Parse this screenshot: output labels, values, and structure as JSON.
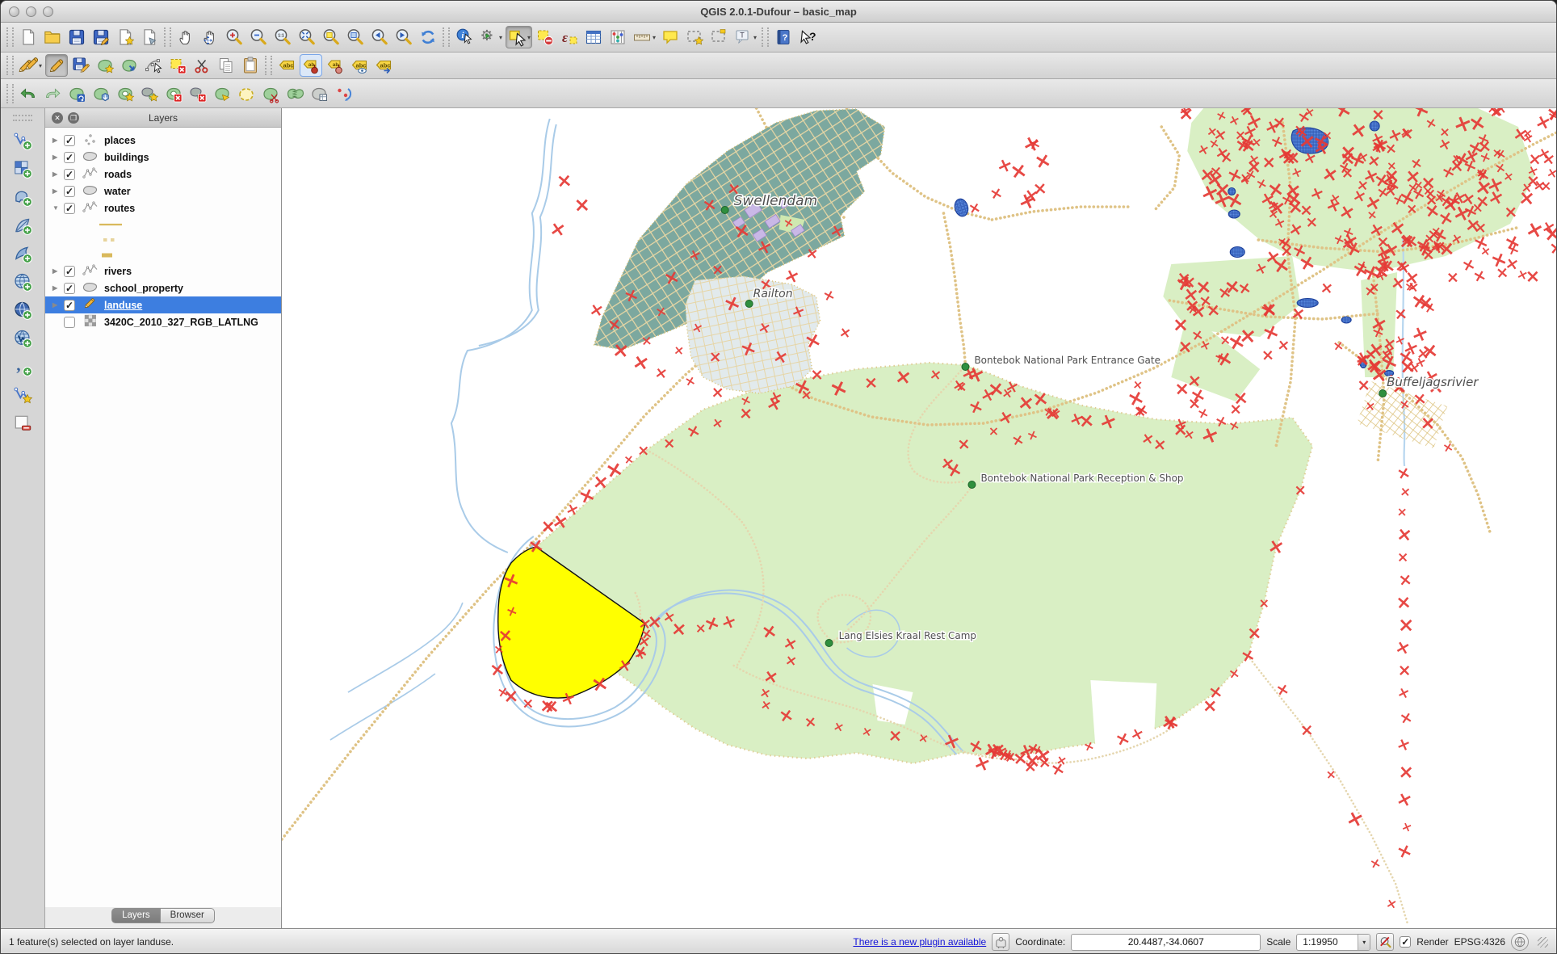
{
  "window": {
    "title": "QGIS 2.0.1-Dufour – basic_map"
  },
  "toolbars": {
    "row1": [
      {
        "sep": true
      },
      {
        "name": "new-project",
        "icon": "new-project"
      },
      {
        "name": "open-project",
        "icon": "open-project"
      },
      {
        "name": "save-project",
        "icon": "save-project"
      },
      {
        "name": "save-project-as",
        "icon": "save-project-as"
      },
      {
        "name": "new-print-composer",
        "icon": "new-composer"
      },
      {
        "name": "composer-manager",
        "icon": "composer-manager"
      },
      {
        "sep": true
      },
      {
        "name": "pan-map",
        "icon": "pan-map"
      },
      {
        "name": "pan-to-selection",
        "icon": "pan-selection"
      },
      {
        "name": "zoom-in",
        "icon": "zoom-in"
      },
      {
        "name": "zoom-out",
        "icon": "zoom-out"
      },
      {
        "name": "zoom-actual-size",
        "icon": "zoom-native"
      },
      {
        "name": "zoom-full-extent",
        "icon": "zoom-full"
      },
      {
        "name": "zoom-to-selection",
        "icon": "zoom-selection"
      },
      {
        "name": "zoom-to-layer",
        "icon": "zoom-layer"
      },
      {
        "name": "zoom-last",
        "icon": "zoom-last"
      },
      {
        "name": "zoom-next",
        "icon": "zoom-next"
      },
      {
        "name": "refresh-map",
        "icon": "refresh"
      },
      {
        "sep": true
      },
      {
        "name": "identify-features",
        "icon": "identify"
      },
      {
        "name": "run-feature-action",
        "icon": "run-action",
        "dropdown": true
      },
      {
        "name": "select-features",
        "icon": "select",
        "dropdown": true,
        "active": true
      },
      {
        "name": "deselect-features",
        "icon": "deselect"
      },
      {
        "name": "select-by-expression",
        "icon": "select-expression"
      },
      {
        "name": "open-attribute-table",
        "icon": "attribute-table"
      },
      {
        "name": "field-calculator",
        "icon": "field-calc"
      },
      {
        "name": "measure-line",
        "icon": "measure",
        "dropdown": true
      },
      {
        "name": "map-tips",
        "icon": "map-tips"
      },
      {
        "name": "new-bookmark",
        "icon": "bookmark-new"
      },
      {
        "name": "show-bookmarks",
        "icon": "bookmark-show"
      },
      {
        "name": "text-annotation",
        "icon": "annotation",
        "dropdown": true
      },
      {
        "sep": true
      },
      {
        "name": "help-contents",
        "icon": "help"
      },
      {
        "name": "whats-this",
        "icon": "whats-this"
      }
    ],
    "row2": [
      {
        "sep": true
      },
      {
        "name": "current-edits",
        "icon": "current-edits",
        "dropdown": true
      },
      {
        "name": "toggle-editing",
        "icon": "toggle-editing",
        "active": true
      },
      {
        "name": "save-layer-edits",
        "icon": "save-edits"
      },
      {
        "name": "add-feature",
        "icon": "add-feature"
      },
      {
        "name": "move-feature",
        "icon": "move-feature"
      },
      {
        "name": "node-tool",
        "icon": "node-tool"
      },
      {
        "name": "delete-selected",
        "icon": "delete-selected"
      },
      {
        "name": "cut-features",
        "icon": "cut"
      },
      {
        "name": "copy-features",
        "icon": "copy"
      },
      {
        "name": "paste-features",
        "icon": "paste"
      },
      {
        "sep": true
      },
      {
        "name": "labeling-options",
        "icon": "labeling"
      },
      {
        "name": "pin-unpin-labels",
        "icon": "pin-labels",
        "highlight": true
      },
      {
        "name": "move-label",
        "icon": "move-label"
      },
      {
        "name": "show-hide-labels",
        "icon": "show-hide-labels"
      },
      {
        "name": "change-label",
        "icon": "change-label"
      }
    ],
    "row3": [
      {
        "sep": true
      },
      {
        "name": "undo",
        "icon": "undo"
      },
      {
        "name": "redo",
        "icon": "redo"
      },
      {
        "name": "rotate-feature",
        "icon": "rotate-feature"
      },
      {
        "name": "simplify-feature",
        "icon": "simplify"
      },
      {
        "name": "add-ring",
        "icon": "add-ring"
      },
      {
        "name": "add-part",
        "icon": "add-part"
      },
      {
        "name": "delete-ring",
        "icon": "delete-ring"
      },
      {
        "name": "delete-part",
        "icon": "delete-part"
      },
      {
        "name": "fill-ring",
        "icon": "fill-ring"
      },
      {
        "name": "offset-curve",
        "icon": "offset-curve"
      },
      {
        "name": "split-features",
        "icon": "split-features"
      },
      {
        "name": "merge-features",
        "icon": "merge-features"
      },
      {
        "name": "merge-feature-attributes",
        "icon": "merge-attrs"
      },
      {
        "name": "rotate-point-symbols",
        "icon": "rotate-points"
      }
    ],
    "left": [
      {
        "name": "add-vector-layer",
        "icon": "add-vector"
      },
      {
        "name": "add-raster-layer",
        "icon": "add-raster"
      },
      {
        "name": "add-postgis-layer",
        "icon": "add-postgis"
      },
      {
        "name": "add-spatialite-layer",
        "icon": "add-spatialite"
      },
      {
        "name": "add-mssql-layer",
        "icon": "add-mssql"
      },
      {
        "name": "add-wms-layer",
        "icon": "add-wms"
      },
      {
        "name": "add-wcs-layer",
        "icon": "add-wcs"
      },
      {
        "name": "add-wfs-layer",
        "icon": "add-wfs"
      },
      {
        "name": "add-delimited-text-layer",
        "icon": "add-delimited"
      },
      {
        "name": "new-shapefile-layer",
        "icon": "new-shapefile"
      },
      {
        "name": "remove-layer",
        "icon": "remove-layer"
      }
    ]
  },
  "layers_panel": {
    "title": "Layers",
    "items": [
      {
        "label": "places",
        "checked": true,
        "symbol": "points",
        "arrow": "right"
      },
      {
        "label": "buildings",
        "checked": true,
        "symbol": "polygon",
        "arrow": "right"
      },
      {
        "label": "roads",
        "checked": true,
        "symbol": "line",
        "arrow": "right"
      },
      {
        "label": "water",
        "checked": true,
        "symbol": "polygon",
        "arrow": "right"
      },
      {
        "label": "routes",
        "checked": true,
        "symbol": "line",
        "arrow": "down",
        "children": [
          {
            "symbol": "route-solid"
          },
          {
            "symbol": "route-dashed"
          },
          {
            "symbol": "route-thick"
          }
        ]
      },
      {
        "label": "rivers",
        "checked": true,
        "symbol": "line",
        "arrow": "right"
      },
      {
        "label": "school_property",
        "checked": true,
        "symbol": "polygon",
        "arrow": "right"
      },
      {
        "label": "landuse",
        "checked": true,
        "symbol": "editing",
        "arrow": "right",
        "selected": true
      },
      {
        "label": "3420C_2010_327_RGB_LATLNG",
        "checked": false,
        "symbol": "raster",
        "arrow": "none"
      }
    ],
    "tabs": [
      {
        "label": "Layers",
        "active": true
      },
      {
        "label": "Browser",
        "active": false
      }
    ]
  },
  "map": {
    "labels": [
      {
        "id": "swellendam",
        "text": "Swellendam"
      },
      {
        "id": "railton",
        "text": "Railton"
      },
      {
        "id": "entrance-gate",
        "text": "Bontebok National Park Entrance Gate"
      },
      {
        "id": "reception-shop",
        "text": "Bontebok National Park Reception & Shop"
      },
      {
        "id": "rest-camp",
        "text": "Lang Elsies Kraal Rest Camp"
      },
      {
        "id": "buffeljagsrivier",
        "text": "Buffeljagsrivier"
      }
    ],
    "colors": {
      "selection_yellow": "#ffff00",
      "park_green": "#d9efc4",
      "town_teal": "#7ca89f",
      "marker_red": "#e53935",
      "road_tan": "#dfc386",
      "river_blue": "#a9cbe8"
    }
  },
  "status_bar": {
    "message": "1 feature(s) selected on layer landuse.",
    "plugin_link": "There is a new plugin available",
    "coordinate_label": "Coordinate:",
    "coordinate_value": "20.4487,-34.0607",
    "scale_label": "Scale",
    "scale_value": "1:19950",
    "render_label": "Render",
    "crs": "EPSG:4326"
  }
}
